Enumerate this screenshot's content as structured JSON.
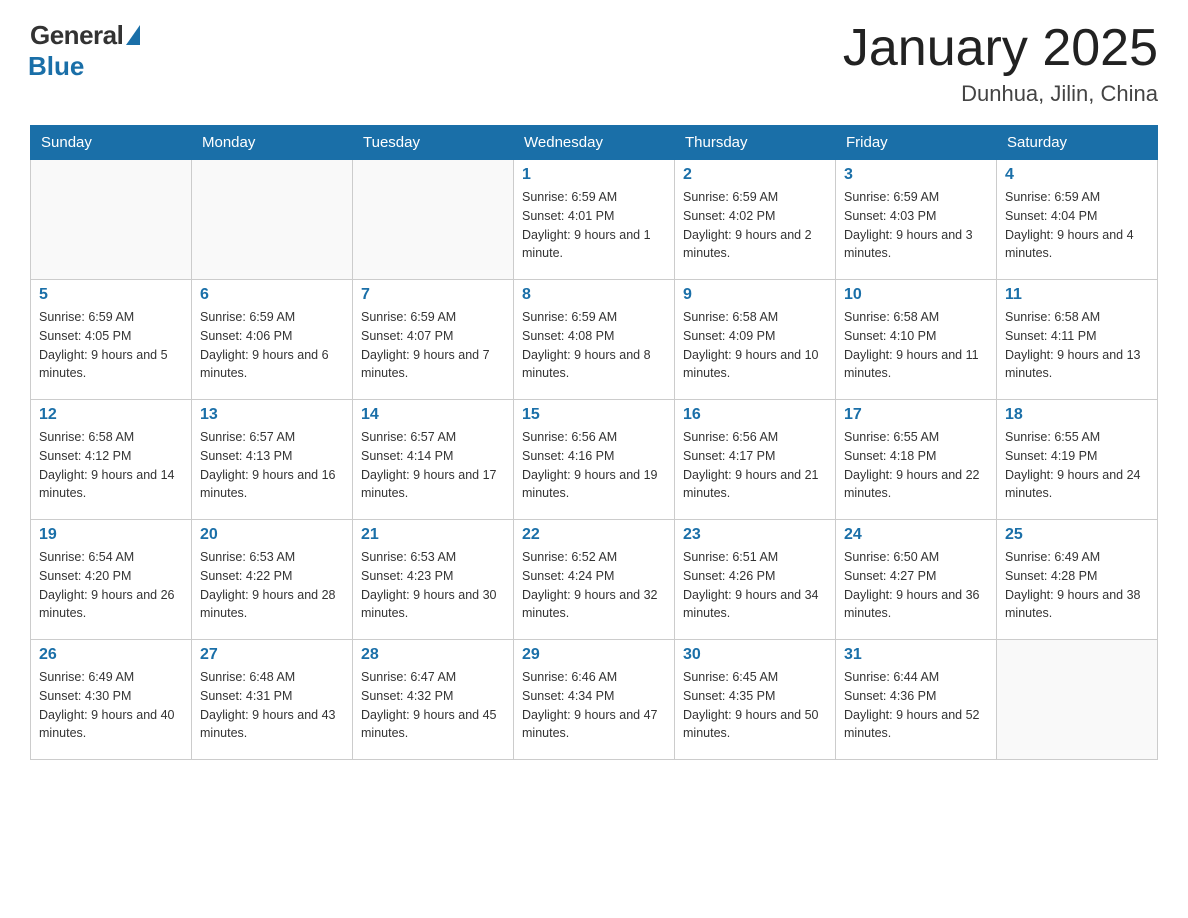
{
  "header": {
    "logo_general": "General",
    "logo_blue": "Blue",
    "month_title": "January 2025",
    "location": "Dunhua, Jilin, China"
  },
  "days_of_week": [
    "Sunday",
    "Monday",
    "Tuesday",
    "Wednesday",
    "Thursday",
    "Friday",
    "Saturday"
  ],
  "weeks": [
    [
      {
        "day": "",
        "info": ""
      },
      {
        "day": "",
        "info": ""
      },
      {
        "day": "",
        "info": ""
      },
      {
        "day": "1",
        "info": "Sunrise: 6:59 AM\nSunset: 4:01 PM\nDaylight: 9 hours and 1 minute."
      },
      {
        "day": "2",
        "info": "Sunrise: 6:59 AM\nSunset: 4:02 PM\nDaylight: 9 hours and 2 minutes."
      },
      {
        "day": "3",
        "info": "Sunrise: 6:59 AM\nSunset: 4:03 PM\nDaylight: 9 hours and 3 minutes."
      },
      {
        "day": "4",
        "info": "Sunrise: 6:59 AM\nSunset: 4:04 PM\nDaylight: 9 hours and 4 minutes."
      }
    ],
    [
      {
        "day": "5",
        "info": "Sunrise: 6:59 AM\nSunset: 4:05 PM\nDaylight: 9 hours and 5 minutes."
      },
      {
        "day": "6",
        "info": "Sunrise: 6:59 AM\nSunset: 4:06 PM\nDaylight: 9 hours and 6 minutes."
      },
      {
        "day": "7",
        "info": "Sunrise: 6:59 AM\nSunset: 4:07 PM\nDaylight: 9 hours and 7 minutes."
      },
      {
        "day": "8",
        "info": "Sunrise: 6:59 AM\nSunset: 4:08 PM\nDaylight: 9 hours and 8 minutes."
      },
      {
        "day": "9",
        "info": "Sunrise: 6:58 AM\nSunset: 4:09 PM\nDaylight: 9 hours and 10 minutes."
      },
      {
        "day": "10",
        "info": "Sunrise: 6:58 AM\nSunset: 4:10 PM\nDaylight: 9 hours and 11 minutes."
      },
      {
        "day": "11",
        "info": "Sunrise: 6:58 AM\nSunset: 4:11 PM\nDaylight: 9 hours and 13 minutes."
      }
    ],
    [
      {
        "day": "12",
        "info": "Sunrise: 6:58 AM\nSunset: 4:12 PM\nDaylight: 9 hours and 14 minutes."
      },
      {
        "day": "13",
        "info": "Sunrise: 6:57 AM\nSunset: 4:13 PM\nDaylight: 9 hours and 16 minutes."
      },
      {
        "day": "14",
        "info": "Sunrise: 6:57 AM\nSunset: 4:14 PM\nDaylight: 9 hours and 17 minutes."
      },
      {
        "day": "15",
        "info": "Sunrise: 6:56 AM\nSunset: 4:16 PM\nDaylight: 9 hours and 19 minutes."
      },
      {
        "day": "16",
        "info": "Sunrise: 6:56 AM\nSunset: 4:17 PM\nDaylight: 9 hours and 21 minutes."
      },
      {
        "day": "17",
        "info": "Sunrise: 6:55 AM\nSunset: 4:18 PM\nDaylight: 9 hours and 22 minutes."
      },
      {
        "day": "18",
        "info": "Sunrise: 6:55 AM\nSunset: 4:19 PM\nDaylight: 9 hours and 24 minutes."
      }
    ],
    [
      {
        "day": "19",
        "info": "Sunrise: 6:54 AM\nSunset: 4:20 PM\nDaylight: 9 hours and 26 minutes."
      },
      {
        "day": "20",
        "info": "Sunrise: 6:53 AM\nSunset: 4:22 PM\nDaylight: 9 hours and 28 minutes."
      },
      {
        "day": "21",
        "info": "Sunrise: 6:53 AM\nSunset: 4:23 PM\nDaylight: 9 hours and 30 minutes."
      },
      {
        "day": "22",
        "info": "Sunrise: 6:52 AM\nSunset: 4:24 PM\nDaylight: 9 hours and 32 minutes."
      },
      {
        "day": "23",
        "info": "Sunrise: 6:51 AM\nSunset: 4:26 PM\nDaylight: 9 hours and 34 minutes."
      },
      {
        "day": "24",
        "info": "Sunrise: 6:50 AM\nSunset: 4:27 PM\nDaylight: 9 hours and 36 minutes."
      },
      {
        "day": "25",
        "info": "Sunrise: 6:49 AM\nSunset: 4:28 PM\nDaylight: 9 hours and 38 minutes."
      }
    ],
    [
      {
        "day": "26",
        "info": "Sunrise: 6:49 AM\nSunset: 4:30 PM\nDaylight: 9 hours and 40 minutes."
      },
      {
        "day": "27",
        "info": "Sunrise: 6:48 AM\nSunset: 4:31 PM\nDaylight: 9 hours and 43 minutes."
      },
      {
        "day": "28",
        "info": "Sunrise: 6:47 AM\nSunset: 4:32 PM\nDaylight: 9 hours and 45 minutes."
      },
      {
        "day": "29",
        "info": "Sunrise: 6:46 AM\nSunset: 4:34 PM\nDaylight: 9 hours and 47 minutes."
      },
      {
        "day": "30",
        "info": "Sunrise: 6:45 AM\nSunset: 4:35 PM\nDaylight: 9 hours and 50 minutes."
      },
      {
        "day": "31",
        "info": "Sunrise: 6:44 AM\nSunset: 4:36 PM\nDaylight: 9 hours and 52 minutes."
      },
      {
        "day": "",
        "info": ""
      }
    ]
  ]
}
